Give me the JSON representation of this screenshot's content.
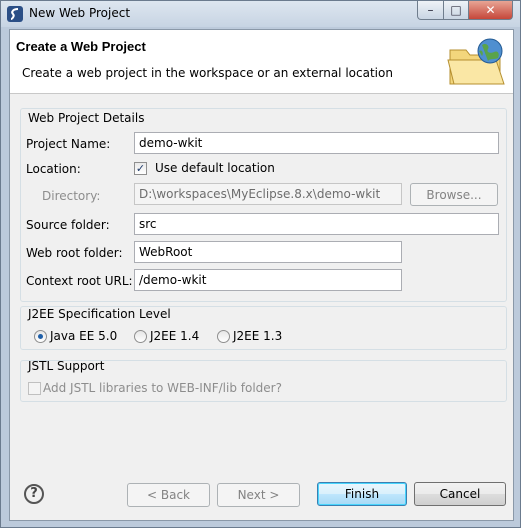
{
  "window": {
    "title": "New Web Project"
  },
  "header": {
    "title": "Create a Web Project",
    "description": "Create a web project in the workspace or an external location"
  },
  "details": {
    "group_label": "Web Project Details",
    "project_name_label": "Project Name:",
    "project_name_value": "demo-wkit",
    "location_label": "Location:",
    "use_default_label": "Use default location",
    "use_default_checked": true,
    "directory_label": "Directory:",
    "directory_value": "D:\\workspaces\\MyEclipse.8.x\\demo-wkit",
    "browse_label": "Browse...",
    "source_folder_label": "Source folder:",
    "source_folder_value": "src",
    "web_root_label": "Web root folder:",
    "web_root_value": "WebRoot",
    "context_root_label": "Context root URL:",
    "context_root_value": "/demo-wkit"
  },
  "j2ee": {
    "group_label": "J2EE Specification Level",
    "options": [
      "Java EE 5.0",
      "J2EE 1.4",
      "J2EE 1.3"
    ],
    "selected": "Java EE 5.0"
  },
  "jstl": {
    "group_label": "JSTL Support",
    "checkbox_label": "Add JSTL libraries to WEB-INF/lib folder?",
    "checked": false,
    "enabled": false
  },
  "buttons": {
    "back": "< Back",
    "next": "Next >",
    "finish": "Finish",
    "cancel": "Cancel"
  },
  "colors": {
    "accent": "#3c7fb1",
    "close_button": "#c6473a",
    "header_bg": "#ffffff",
    "dialog_bg": "#f0f0f0"
  },
  "icons": {
    "app": "myeclipse-logo-icon",
    "header": "folder-globe-icon",
    "help": "help-icon",
    "window_controls": [
      "minimize-icon",
      "maximize-icon",
      "close-icon"
    ]
  }
}
